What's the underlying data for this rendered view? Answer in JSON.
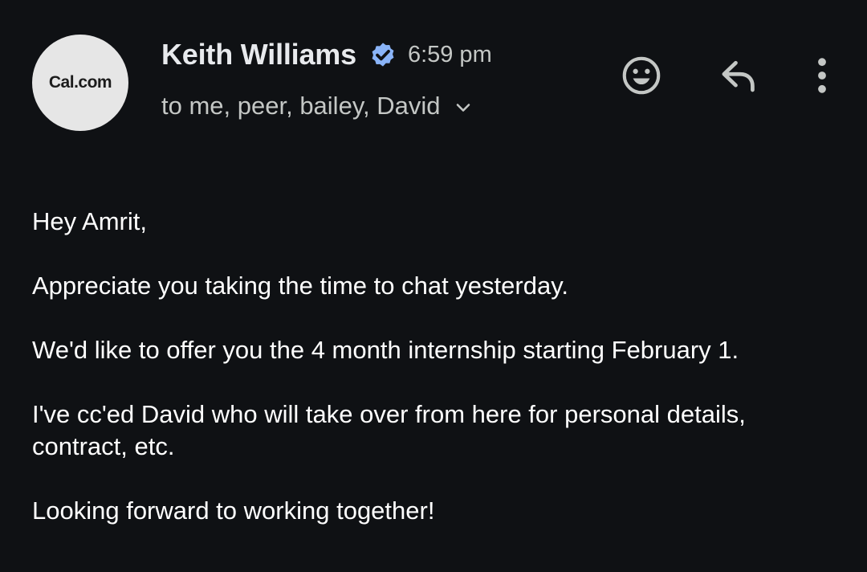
{
  "avatar": {
    "text": "Cal.com"
  },
  "header": {
    "sender_name": "Keith Williams",
    "time": "6:59 pm",
    "recipients": "to me, peer, bailey, David"
  },
  "actions": {
    "emoji": {
      "icon": "smiley-icon"
    },
    "reply": {
      "icon": "reply-icon"
    },
    "more": {
      "icon": "more-vert-icon"
    }
  },
  "message": {
    "paragraphs": [
      "Hey Amrit,",
      "Appreciate you taking the time to chat yesterday.",
      "We'd like to offer you the 4 month internship starting February 1.",
      "I've cc'ed David who will take over from here for personal details, contract, etc.",
      "Looking forward to working together!"
    ]
  },
  "colors": {
    "background": "#0f1114",
    "verified_badge": "#8ab4f8",
    "secondary_text": "#c4c7c5",
    "icon": "#c4c7c5"
  }
}
